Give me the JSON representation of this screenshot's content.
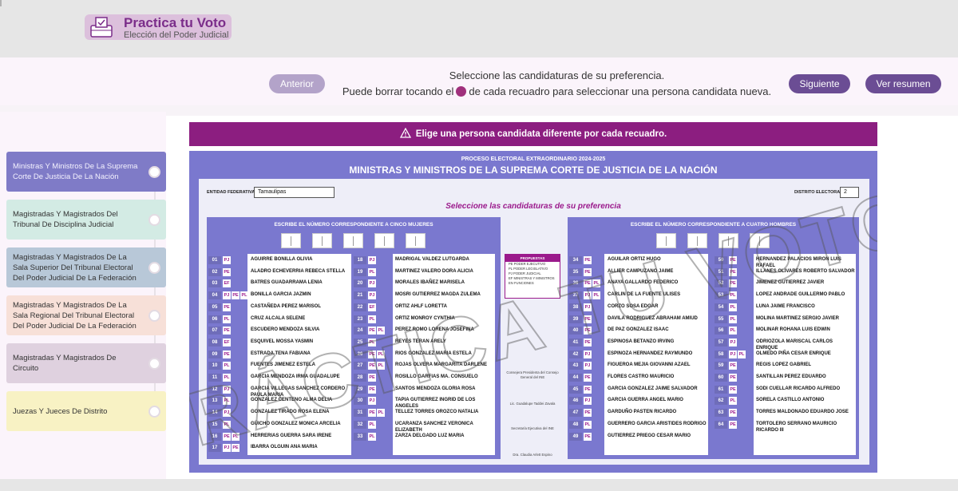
{
  "header": {
    "logo_title": "Practica tu Voto",
    "logo_subtitle": "Elección del Poder Judicial"
  },
  "nav": {
    "prev_label": "Anterior",
    "next_label": "Siguiente",
    "summary_label": "Ver resumen",
    "instruction_line1": "Seleccione las candidaturas de su preferencia.",
    "instruction_line2_before": "Puede borrar tocando el",
    "instruction_line2_after": "de cada recuadro para seleccionar una persona candidata nueva."
  },
  "sidebar": {
    "items": [
      {
        "label": "Ministras Y Ministros De La Suprema Corte De Justicia De La Nación",
        "color": "#7f7bc7"
      },
      {
        "label": "Magistradas Y Magistrados Del Tribunal De Disciplina Judicial",
        "color": "#d3ebe4"
      },
      {
        "label": "Magistradas Y Magistrados De La Sala Superior Del Tribunal Electoral Del Poder Judicial De La Federación",
        "color": "#b8c8d8"
      },
      {
        "label": "Magistradas Y Magistrados De La Sala Regional Del Tribunal Electoral Del Poder Judicial De La Federación",
        "color": "#f7e0d8"
      },
      {
        "label": "Magistradas Y Magistrados De Circuito",
        "color": "#dfd1df"
      },
      {
        "label": "Juezas Y Jueces De Distrito",
        "color": "#f8f2c4"
      }
    ]
  },
  "warning": {
    "text": "Elige una persona candidata diferente por cada recuadro."
  },
  "ballot": {
    "process": "PROCESO ELECTORAL EXTRAORDINARIO 2024-2025",
    "title": "MINISTRAS Y MINISTROS DE LA SUPREMA CORTE DE JUSTICIA DE LA NACIÓN",
    "entidad_label": "ENTIDAD FEDERATIVA",
    "entidad_value": "Tamaulipas",
    "distrito_label": "DISTRITO ELECTORAL",
    "distrito_value": "2",
    "select_heading": "Seleccione las candidaturas de su preferencia",
    "women_heading": "ESCRIBE EL NÚMERO CORRESPONDIENTE A CINCO MUJERES",
    "men_heading": "ESCRIBE EL NÚMERO CORRESPONDIENTE A CUATRO HOMBRES",
    "watermark": "PRÁCTICA TU VOTO",
    "legend": {
      "title": "PROPUESTAS",
      "items": [
        "PE  PODER EJECUTIVO",
        "PL  PODER LEGISLATIVO",
        "PJ  PODER JUDICIAL",
        "EF  MINISTRAS Y MINISTROS EN FUNCIONES"
      ]
    },
    "center_texts": [
      "Consejera Presidenta del Consejo General del INE",
      "Lic. Guadalupe Taddei Zavala",
      "Secretaría Ejecutiva del INE",
      "Dra. Claudia Arlett Espino"
    ],
    "women_left": [
      {
        "num": "01",
        "badges": [
          "PJ"
        ],
        "name": "AGUIRRE BONILLA OLIVIA"
      },
      {
        "num": "02",
        "badges": [
          "PE"
        ],
        "name": "ALADRO ECHEVERRIA REBECA STELLA"
      },
      {
        "num": "03",
        "badges": [
          "EF"
        ],
        "name": "BATRES GUADARRAMA LENIA"
      },
      {
        "num": "04",
        "badges": [
          "PJ",
          "PE",
          "PL"
        ],
        "name": "BONILLA GARCIA JAZMIN"
      },
      {
        "num": "05",
        "badges": [
          "PE"
        ],
        "name": "CASTAÑEDA PEREZ MARISOL"
      },
      {
        "num": "06",
        "badges": [
          "PL"
        ],
        "name": "CRUZ ALCALA SELENE"
      },
      {
        "num": "07",
        "badges": [
          "PE"
        ],
        "name": "ESCUDERO MENDOZA SILVIA"
      },
      {
        "num": "08",
        "badges": [
          "EF"
        ],
        "name": "ESQUIVEL MOSSA YASMIN"
      },
      {
        "num": "09",
        "badges": [
          "PE"
        ],
        "name": "ESTRADA TENA FABIANA"
      },
      {
        "num": "10",
        "badges": [
          "PL"
        ],
        "name": "FUENTES JIMENEZ ESTELA"
      },
      {
        "num": "11",
        "badges": [
          "PL"
        ],
        "name": "GARCIA MENDOZA IRMA GUADALUPE"
      },
      {
        "num": "12",
        "badges": [
          "PJ"
        ],
        "name": "GARCIA VILLEGAS SANCHEZ CORDERO PAULA MARIA"
      },
      {
        "num": "13",
        "badges": [
          "PL"
        ],
        "name": "GONZALEZ CENTENO ALMA DELIA"
      },
      {
        "num": "14",
        "badges": [
          "PJ"
        ],
        "name": "GONZALEZ TIRADO ROSA ELENA"
      },
      {
        "num": "15",
        "badges": [
          "PL"
        ],
        "name": "GÜICHO GONZALEZ MONICA ARCELIA"
      },
      {
        "num": "16",
        "badges": [
          "PE",
          "PL"
        ],
        "name": "HERRERIAS GUERRA SARA IRENE"
      },
      {
        "num": "17",
        "badges": [
          "PJ",
          "PE"
        ],
        "name": "IBARRA OLGUIN ANA MARIA"
      }
    ],
    "women_right": [
      {
        "num": "18",
        "badges": [
          "PJ"
        ],
        "name": "MADRIGAL VALDEZ LUTGARDA"
      },
      {
        "num": "19",
        "badges": [
          "PL"
        ],
        "name": "MARTINEZ VALERO DORA ALICIA"
      },
      {
        "num": "20",
        "badges": [
          "PJ"
        ],
        "name": "MORALES IBAÑEZ MARISELA"
      },
      {
        "num": "21",
        "badges": [
          "PJ"
        ],
        "name": "MOSRI GUTIERREZ MAGDA ZULEMA"
      },
      {
        "num": "22",
        "badges": [
          "EF"
        ],
        "name": "ORTIZ AHLF LORETTA"
      },
      {
        "num": "23",
        "badges": [
          "PL"
        ],
        "name": "ORTIZ MONROY CYNTHIA"
      },
      {
        "num": "24",
        "badges": [
          "PE",
          "PL"
        ],
        "name": "PEREZ ROMO LORENA JOSEFINA"
      },
      {
        "num": "25",
        "badges": [
          "PL"
        ],
        "name": "REYES TERAN ARELY"
      },
      {
        "num": "26",
        "badges": [
          "PE",
          "PL"
        ],
        "name": "RIOS GONZALEZ MARIA ESTELA"
      },
      {
        "num": "27",
        "badges": [
          "PE",
          "PL"
        ],
        "name": "ROJAS OLVERA MARGARITA DARLENE"
      },
      {
        "num": "28",
        "badges": [
          "PE"
        ],
        "name": "ROSILLO GARFIAS MA. CONSUELO"
      },
      {
        "num": "29",
        "badges": [
          "PE"
        ],
        "name": "SANTOS MENDOZA GLORIA ROSA"
      },
      {
        "num": "30",
        "badges": [
          "PJ"
        ],
        "name": "TAPIA GUTIERREZ INGRID DE LOS ANGELES"
      },
      {
        "num": "31",
        "badges": [
          "PE",
          "PL"
        ],
        "name": "TELLEZ TORRES OROZCO NATALIA"
      },
      {
        "num": "32",
        "badges": [
          "PL"
        ],
        "name": "UCARANZA SANCHEZ VERONICA ELIZABETH"
      },
      {
        "num": "33",
        "badges": [
          "PL"
        ],
        "name": "ZARZA DELGADO LUZ MARIA"
      }
    ],
    "men_left": [
      {
        "num": "34",
        "badges": [
          "PE"
        ],
        "name": "AGUILAR ORTIZ HUGO"
      },
      {
        "num": "35",
        "badges": [
          "PE"
        ],
        "name": "ALLIER CAMPUZANO JAIME"
      },
      {
        "num": "36",
        "badges": [
          "PE",
          "PL"
        ],
        "name": "ANAYA GALLARDO FEDERICO"
      },
      {
        "num": "37",
        "badges": [
          "PJ",
          "PL"
        ],
        "name": "CARLIN DE LA FUENTE ULISES"
      },
      {
        "num": "38",
        "badges": [
          "PJ"
        ],
        "name": "CORZO SOSA EDGAR"
      },
      {
        "num": "39",
        "badges": [
          "PE"
        ],
        "name": "DAVILA RODRIGUEZ ABRAHAM AMIUD"
      },
      {
        "num": "40",
        "badges": [
          "PE"
        ],
        "name": "DE PAZ GONZALEZ ISAAC"
      },
      {
        "num": "41",
        "badges": [
          "PE"
        ],
        "name": "ESPINOSA BETANZO IRVING"
      },
      {
        "num": "42",
        "badges": [
          "PJ"
        ],
        "name": "ESPINOZA HERNANDEZ RAYMUNDO"
      },
      {
        "num": "43",
        "badges": [
          "PJ"
        ],
        "name": "FIGUEROA MEJIA GIOVANNI AZAEL"
      },
      {
        "num": "44",
        "badges": [
          "PE"
        ],
        "name": "FLORES CASTRO MAURICIO"
      },
      {
        "num": "45",
        "badges": [
          "PE"
        ],
        "name": "GARCIA GONZALEZ JAIME SALVADOR"
      },
      {
        "num": "46",
        "badges": [
          "PJ"
        ],
        "name": "GARCIA GUERRA ANGEL MARIO"
      },
      {
        "num": "47",
        "badges": [
          "PE"
        ],
        "name": "GARDUÑO PASTEN RICARDO"
      },
      {
        "num": "48",
        "badges": [
          "PL"
        ],
        "name": "GUERRERO GARCIA ARISTIDES RODRIGO"
      },
      {
        "num": "49",
        "badges": [
          "PE"
        ],
        "name": "GUTIERREZ PRIEGO CESAR MARIO"
      }
    ],
    "men_right": [
      {
        "num": "50",
        "badges": [
          "PE"
        ],
        "name": "HERNANDEZ PALACIOS MIRON LUIS RAFAEL"
      },
      {
        "num": "51",
        "badges": [
          "PE"
        ],
        "name": "ILLANES OLIVARES ROBERTO SALVADOR"
      },
      {
        "num": "52",
        "badges": [
          "PE"
        ],
        "name": "JIMENEZ GUTIERREZ JAVIER"
      },
      {
        "num": "53",
        "badges": [
          "PL"
        ],
        "name": "LOPEZ ANDRADE GUILLERMO PABLO"
      },
      {
        "num": "54",
        "badges": [
          "PL"
        ],
        "name": "LUNA JAIME FRANCISCO"
      },
      {
        "num": "55",
        "badges": [
          "PL"
        ],
        "name": "MOLINA MARTINEZ SERGIO JAVIER"
      },
      {
        "num": "56",
        "badges": [
          "PL"
        ],
        "name": "MOLINAR ROHANA LUIS EDWIN"
      },
      {
        "num": "57",
        "badges": [
          "PJ"
        ],
        "name": "ODRIOZOLA MARISCAL CARLOS ENRIQUE"
      },
      {
        "num": "58",
        "badges": [
          "PJ",
          "PL"
        ],
        "name": "OLMEDO PIÑA CESAR ENRIQUE"
      },
      {
        "num": "59",
        "badges": [
          "PE"
        ],
        "name": "REGIS LOPEZ GABRIEL"
      },
      {
        "num": "60",
        "badges": [
          "PE"
        ],
        "name": "SANTILLAN PEREZ EDUARDO"
      },
      {
        "num": "61",
        "badges": [
          "PE"
        ],
        "name": "SODI CUELLAR RICARDO ALFREDO"
      },
      {
        "num": "62",
        "badges": [
          "PL"
        ],
        "name": "SORELA CASTILLO ANTONIO"
      },
      {
        "num": "63",
        "badges": [
          "PE"
        ],
        "name": "TORRES MALDONADO EDUARDO JOSE"
      },
      {
        "num": "64",
        "badges": [
          "PE"
        ],
        "name": "TORTOLERO SERRANO MAURICIO RICARDO III"
      }
    ]
  }
}
